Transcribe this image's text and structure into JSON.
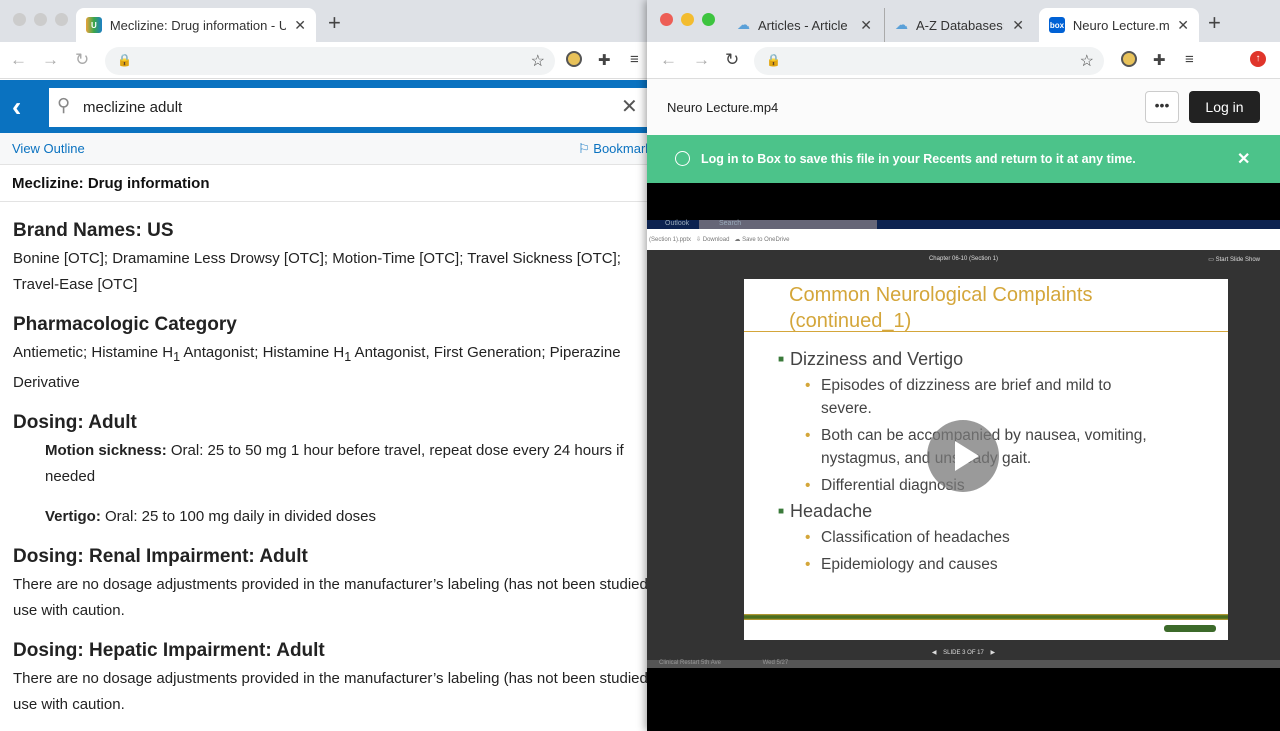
{
  "left_window": {
    "tab": {
      "title": "Meclizine: Drug information - U",
      "favicon": "U"
    },
    "search": {
      "query": "meclizine adult"
    },
    "toolbar": {
      "view_outline": "View Outline",
      "bookmark": "Bookmark"
    },
    "doc_title": "Meclizine: Drug information",
    "sections": {
      "brand": {
        "heading": "Brand Names: US",
        "line1": "Bonine [OTC]; Dramamine Less Drowsy [OTC]; Motion-Time [OTC]; Travel Sickness [OTC];",
        "line2": "Travel-Ease [OTC]"
      },
      "pharm": {
        "heading": "Pharmacologic Category",
        "line1a": "Antiemetic; Histamine H",
        "sub": "1",
        "line1b": " Antagonist; Histamine H",
        "line1c": " Antagonist, First Generation; Piperazine",
        "line2": "Derivative"
      },
      "dosing": {
        "heading": "Dosing: Adult",
        "motion_label": "Motion sickness:",
        "motion_text": " Oral: 25 to 50 mg 1 hour before travel, repeat dose every 24 hours if",
        "motion_text2": "needed",
        "vertigo_label": "Vertigo:",
        "vertigo_text": " Oral: 25 to 100 mg daily in divided doses"
      },
      "renal": {
        "heading": "Dosing: Renal Impairment: Adult",
        "line1": "There are no dosage adjustments provided in the manufacturer’s labeling (has not been studied);",
        "line2": "use with caution."
      },
      "hepatic": {
        "heading": "Dosing: Hepatic Impairment: Adult",
        "line1": "There are no dosage adjustments provided in the manufacturer’s labeling (has not been studied);",
        "line2": "use with caution."
      }
    }
  },
  "right_window": {
    "tabs": [
      {
        "title": "Articles - Article"
      },
      {
        "title": "A-Z Databases:"
      },
      {
        "title": "Neuro Lecture.m",
        "favicon": "box"
      }
    ],
    "file_name": "Neuro Lecture.mp4",
    "more_label": "•••",
    "login_label": "Log in",
    "banner": "Log in to Box to save this file in your Recents and return to it at any time.",
    "video": {
      "outlook": "Outlook",
      "search": "Search",
      "file": "(Section 1).pptx",
      "download": "Download",
      "save": "Save to OneDrive",
      "chapter": "Chapter 06-10 (Section 1)",
      "slideshow": "Start Slide Show",
      "slide_title_1": "Common Neurological Complaints",
      "slide_title_2": "(continued_1)",
      "bullets": {
        "b1": "Dizziness and Vertigo",
        "b1a": "Episodes of dizziness are brief and mild to",
        "b1a2": "severe.",
        "b1b": "Both can be accompanied by nausea, vomiting,",
        "b1b2": "nystagmus, and unsteady gait.",
        "b1c": "Differential diagnosis",
        "b2": "Headache",
        "b2a": "Classification of headaches",
        "b2b": "Epidemiology and causes"
      },
      "slide_counter": "SLIDE 3 OF 17",
      "email_row": "Clinical Restart 5th Ave",
      "email_date": "Wed 5/27"
    }
  },
  "colors": {
    "uptodate_blue": "#0a72c0",
    "box_green": "#4cc38a"
  }
}
